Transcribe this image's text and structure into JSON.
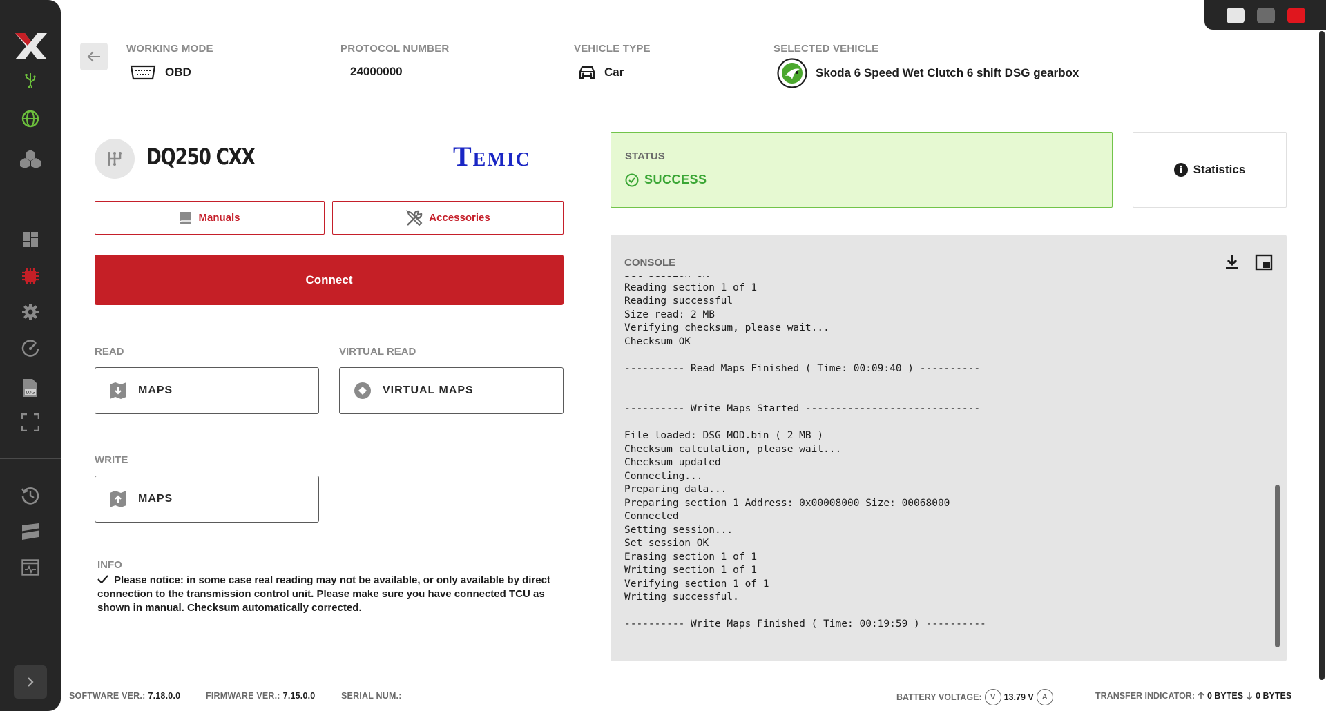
{
  "window": {
    "controls": [
      {
        "name": "minimize",
        "color": "#e6e6e6"
      },
      {
        "name": "maximize",
        "color": "#6b6b6b"
      },
      {
        "name": "close",
        "color": "#e0161e"
      }
    ]
  },
  "sidebar": {
    "accent": "#c51f26",
    "items": [
      {
        "id": "usb",
        "icon": "usb-icon"
      },
      {
        "id": "globe",
        "icon": "globe-icon"
      },
      {
        "id": "packages",
        "icon": "cubes-icon"
      },
      {
        "id": "dashboard",
        "icon": "dashboard-icon"
      },
      {
        "id": "ecu",
        "icon": "chip-icon"
      },
      {
        "id": "settings",
        "icon": "gear-icon"
      },
      {
        "id": "performance",
        "icon": "gauge-icon"
      },
      {
        "id": "log",
        "icon": "log-file-icon"
      },
      {
        "id": "fullscreen",
        "icon": "fullscreen-icon"
      },
      {
        "id": "history",
        "icon": "history-icon"
      },
      {
        "id": "flag",
        "icon": "flag-icon"
      },
      {
        "id": "monitor",
        "icon": "monitor-icon"
      }
    ]
  },
  "header": {
    "working_mode": {
      "label": "WORKING MODE",
      "value": "OBD"
    },
    "protocol_number": {
      "label": "PROTOCOL NUMBER",
      "value": "24000000"
    },
    "vehicle_type": {
      "label": "VEHICLE TYPE",
      "value": "Car"
    },
    "selected_vehicle": {
      "label": "SELECTED VEHICLE",
      "value": "Skoda 6 Speed Wet Clutch 6 shift DSG gearbox"
    }
  },
  "ecu": {
    "name": "DQ250 CXX",
    "brand": "Temic",
    "manuals_label": "Manuals",
    "accessories_label": "Accessories",
    "connect_label": "Connect"
  },
  "read": {
    "label": "READ",
    "maps_label": "MAPS"
  },
  "virtual_read": {
    "label": "VIRTUAL READ",
    "maps_label": "VIRTUAL MAPS"
  },
  "write": {
    "label": "WRITE",
    "maps_label": "MAPS"
  },
  "info": {
    "label": "INFO",
    "text": "Please notice: in some case real reading may not be available, or only available by direct connection to the transmission control unit. Please make sure you have connected TCU as shown in manual. Checksum automatically corrected."
  },
  "status": {
    "label": "STATUS",
    "value": "SUCCESS",
    "color": "#3aa635",
    "statistics_label": "Statistics"
  },
  "console": {
    "label": "CONSOLE",
    "lines": [
      "Set session OK",
      "Reading section 1 of 1",
      "Reading successful",
      "Size read: 2 MB",
      "Verifying checksum, please wait...",
      "Checksum OK",
      "",
      "---------- Read Maps Finished ( Time: 00:09:40 ) ----------",
      "",
      "",
      "---------- Write Maps Started -----------------------------",
      "",
      "File loaded: DSG MOD.bin ( 2 MB )",
      "Checksum calculation, please wait...",
      "Checksum updated",
      "Connecting...",
      "Preparing data...",
      "Preparing section 1 Address: 0x00008000 Size: 00068000",
      "Connected",
      "Setting session...",
      "Set session OK",
      "Erasing section 1 of 1",
      "Writing section 1 of 1",
      "Verifying section 1 of 1",
      "Writing successful.",
      "",
      "---------- Write Maps Finished ( Time: 00:19:59 ) ----------"
    ]
  },
  "footer": {
    "software_label": "SOFTWARE VER.:",
    "software_value": "7.18.0.0",
    "firmware_label": "FIRMWARE VER.:",
    "firmware_value": "7.15.0.0",
    "serial_label": "SERIAL NUM.:",
    "battery_label": "BATTERY VOLTAGE:",
    "battery_v_badge": "V",
    "battery_value": "13.79 V",
    "battery_a_badge": "A",
    "transfer_label": "TRANSFER INDICATOR:",
    "transfer_up": "0 BYTES",
    "transfer_down": "0 BYTES"
  }
}
